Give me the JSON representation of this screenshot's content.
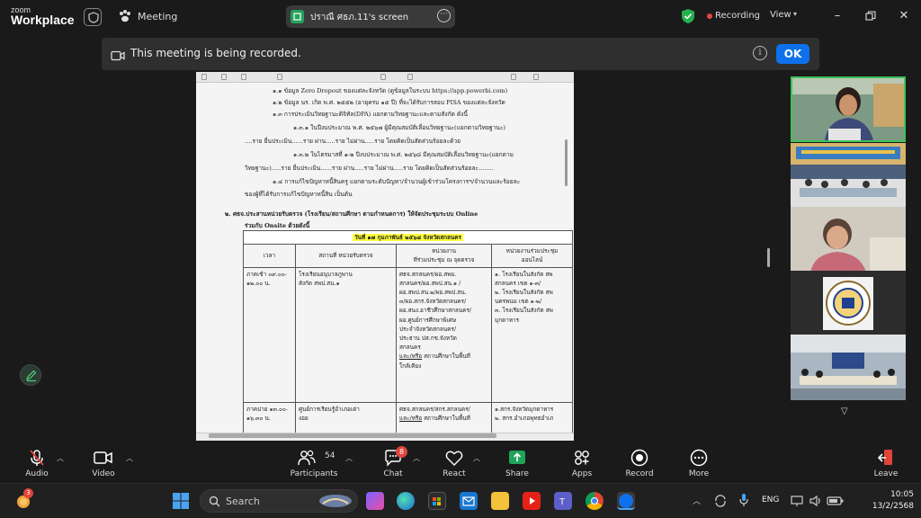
{
  "app": {
    "logo_top": "zoom",
    "logo_bottom": "Workplace",
    "meeting_label": "Meeting",
    "share_label": "ปราณี ศธภ.11's screen",
    "recording_label": "Recording",
    "view_label": "View"
  },
  "banner": {
    "text": "This meeting is being recorded.",
    "ok_label": "OK"
  },
  "document": {
    "lines": [
      "๑.๑ ข้อมูล Zero Dropout ของแต่ละจังหวัด (ดูข้อมูลในระบบ https://app.powerbi.com)",
      "๑.๒ ข้อมูล นร. เกิด พ.ศ. ๒๕๕๒ (อายุครบ ๑๕ ปี) ที่จะได้รับการสอบ PISA ของแต่ละจังหวัด",
      "๑.๓ การประเมินวิทยฐานะดิจิทัล(DPA) แยกตามวิทยฐานะและตามสังกัด ดังนี้",
      "๑.๓.๑ ในปีงบประมาณ พ.ศ. ๒๕๖๗ ผู้มีคุณสมบัติเลื่อนวิทยฐานะ(แยกตามวิทยฐานะ)",
      "....ราย ยื่นประเมิน......ราย ผ่าน.....ราย ไม่ผ่าน.....ราย โดยคิดเป็นสัดส่วนร้อยละด้วย",
      "๑.๓.๒ ในไตรมาสที่ ๑-๒ ปีงบประมาณ พ.ศ. ๒๕๖๘ มีคุณสมบัติเลื่อนวิทยฐานะ(แยกตาม",
      "วิทยฐานะ).....ราย ยื่นประเมิน......ราย ผ่าน.....ราย ไม่ผ่าน.....ราย โดยคิดเป็นสัดส่วนร้อยละ........",
      "๑.๔ การแก้ไขปัญหาหนี้สินครู แยกตามระดับปัญหา/จำนวนผู้เข้าร่วมโครงการฯ/จำนวนและร้อยละ",
      "ของผู้ที่ได้รับการแก้ไขปัญหาหนี้สิน เป็นต้น",
      "๒. ศธจ.ประสานหน่วยรับตรวจ (โรงเรียน/สถานศึกษา ตามกำหนดการ) ให้จัดประชุมระบบ Online",
      "ร่วมกับ Onsite ด้วยดังนี้"
    ],
    "table": {
      "day_title": "วันที่ ๑๗ กุมภาพันธ์ ๒๕๖๘ จังหวัดสกลนคร",
      "headers": [
        "เวลา",
        "สถานที่ หน่วยรับตรวจ",
        "หน่วยงาน\nที่ร่วมประชุม ณ จุดตรวจ",
        "หน่วยงานร่วมประชุม\nออนไลน์"
      ],
      "row1": {
        "time": "ภาคเช้า ๐๙.๐๐-\n๑๒.๐๐ น.",
        "place": "โรงเรียนอนุบาลภูพาน\nสังกัด สพป.สน.๑",
        "attend": "ศธจ.สกลนคร/ผอ.สพม.\nสกลนคร/ผอ.สพป.สน.๑ /\nผอ.สพป.สน.๒/ผอ.สพป.สน.\n๓/ผอ.สกร.จังหวัดสกลนคร/\nผอ.สนง.อาชีวศึกษาสกลนคร/\nผอ.ศูนย์การศึกษาพิเศษ\nประจำจังหวัดสกลนคร/\nประธาน ปส.กช.จังหวัด\nสกลนคร",
        "attend_u": "และ/หรือ",
        "attend_tail": " สถานศึกษาในพื้นที่",
        "attend_end": "ใกล้เคียง",
        "online": "๑. โรงเรียนในสังกัด สพ\nสกลนคร เขต ๑-๓/\n๒. โรงเรียนในสังกัด สพ\nนครพนม เขต ๑-๒/\n๓. โรงเรียนในสังกัด สพ\nมุกดาหาร"
      },
      "row2": {
        "time": "ภาคบ่าย ๑๓.๐๐-\n๑๖.๓๐ น.",
        "place": "ศูนย์การเรียนรู้อำเภอเต่า\nงอย",
        "attend": "ศธจ.สกลนคร/สกร.สกลนคร/",
        "attend_u": "และ/หรือ",
        "attend_tail": " สถานศึกษาในพื้นที่",
        "online": "๑.สกร.จังหวัดมุกดาหาร\n๒. สกร.อำเภอพุทธอำเภ"
      }
    }
  },
  "controls": [
    {
      "id": "audio",
      "label": "Audio"
    },
    {
      "id": "video",
      "label": "Video"
    },
    {
      "id": "participants",
      "label": "Participants",
      "count": "54"
    },
    {
      "id": "chat",
      "label": "Chat",
      "badge": "8"
    },
    {
      "id": "react",
      "label": "React"
    },
    {
      "id": "share",
      "label": "Share"
    },
    {
      "id": "apps",
      "label": "Apps"
    },
    {
      "id": "record",
      "label": "Record"
    },
    {
      "id": "more",
      "label": "More"
    },
    {
      "id": "leave",
      "label": "Leave"
    }
  ],
  "taskbar": {
    "search_placeholder": "Search",
    "notif_badge": "3",
    "language": "ENG",
    "time": "10:05",
    "date": "13/2/2568"
  },
  "colors": {
    "zoom_blue": "#0e71eb",
    "record_red": "#e64545",
    "share_green": "#22a35a",
    "active_speaker": "#3ec15a",
    "leave_red": "#e0443a"
  }
}
